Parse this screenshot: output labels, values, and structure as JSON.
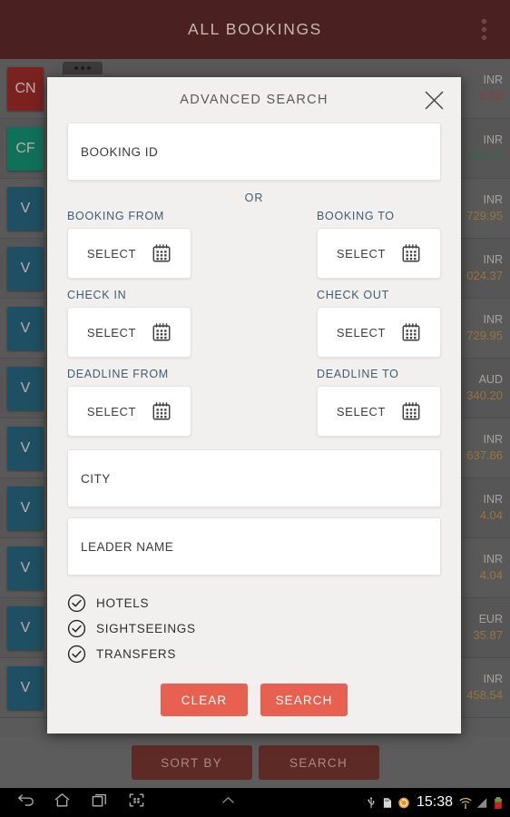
{
  "app": {
    "header_title": "ALL BOOKINGS",
    "overflow_menu_name": "more-options"
  },
  "background_list": {
    "rows": [
      {
        "badge": "CN",
        "badge_color": "#7b2220",
        "currency": "INR",
        "amount": "0.00",
        "amount_color": "#8e3b33"
      },
      {
        "badge": "CF",
        "badge_color": "#10705a",
        "currency": "INR",
        "amount": "659.77",
        "amount_color": "#2f6b47"
      },
      {
        "badge": "V",
        "badge_color": "#1e4f63",
        "currency": "INR",
        "amount": "729.95",
        "amount_color": "#96763f"
      },
      {
        "badge": "V",
        "badge_color": "#1e4f63",
        "currency": "INR",
        "amount": "024.37",
        "amount_color": "#96763f"
      },
      {
        "badge": "V",
        "badge_color": "#1e4f63",
        "currency": "INR",
        "amount": "729.95",
        "amount_color": "#96763f"
      },
      {
        "badge": "V",
        "badge_color": "#1e4f63",
        "currency": "AUD",
        "amount": "340.20",
        "amount_color": "#96763f"
      },
      {
        "badge": "V",
        "badge_color": "#1e4f63",
        "currency": "INR",
        "amount": "637.86",
        "amount_color": "#96763f"
      },
      {
        "badge": "V",
        "badge_color": "#1e4f63",
        "currency": "INR",
        "amount": "4.04",
        "amount_color": "#96763f"
      },
      {
        "badge": "V",
        "badge_color": "#1e4f63",
        "currency": "INR",
        "amount": "4.04",
        "amount_color": "#96763f"
      },
      {
        "badge": "V",
        "badge_color": "#1e4f63",
        "currency": "EUR",
        "amount": "35.87",
        "amount_color": "#96763f"
      },
      {
        "badge": "V",
        "badge_color": "#1e4f63",
        "currency": "INR",
        "amount": "458.54",
        "amount_color": "#96763f"
      }
    ]
  },
  "bottom_bar": {
    "sort_by_label": "SORT BY",
    "search_label": "SEARCH"
  },
  "dialog": {
    "title": "ADVANCED SEARCH",
    "close_icon": "close-icon",
    "booking_id_placeholder": "BOOKING ID",
    "or_text": "OR",
    "select_text": "SELECT",
    "calendar_icon": "calendar-icon",
    "date_fields": [
      {
        "label": "BOOKING FROM",
        "value": "SELECT"
      },
      {
        "label": "BOOKING TO",
        "value": "SELECT"
      },
      {
        "label": "CHECK IN",
        "value": "SELECT"
      },
      {
        "label": "CHECK OUT",
        "value": "SELECT"
      },
      {
        "label": "DEADLINE FROM",
        "value": "SELECT"
      },
      {
        "label": "DEADLINE TO",
        "value": "SELECT"
      }
    ],
    "city_placeholder": "CITY",
    "leader_name_placeholder": "LEADER NAME",
    "checkboxes": [
      {
        "label": "HOTELS",
        "checked": true
      },
      {
        "label": "SIGHTSEEINGS",
        "checked": true
      },
      {
        "label": "TRANSFERS",
        "checked": true
      }
    ],
    "clear_label": "CLEAR",
    "search_label": "SEARCH",
    "accent_button_color": "#e8604f",
    "label_color": "#3e5c76"
  },
  "status_bar": {
    "time": "15:38",
    "icons": [
      "usb-icon",
      "sd-card-icon",
      "sync-icon",
      "wifi-icon",
      "signal-icon",
      "battery-icon"
    ]
  },
  "nav_bar": {
    "icons": [
      "back-icon",
      "home-icon",
      "recents-icon",
      "screenshot-icon",
      "expand-up-icon"
    ]
  }
}
